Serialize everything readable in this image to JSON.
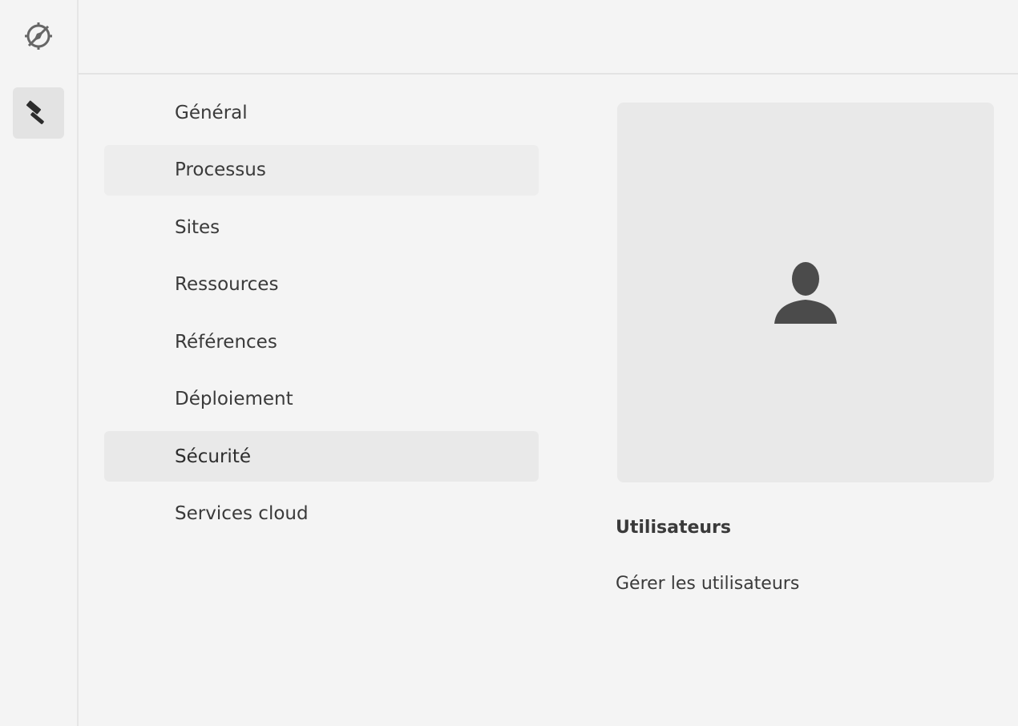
{
  "rail": {
    "items": [
      {
        "icon": "compass-off-icon"
      },
      {
        "icon": "hammer-icon",
        "selected": true
      }
    ]
  },
  "nav": {
    "items": [
      {
        "label": "Général"
      },
      {
        "label": "Processus"
      },
      {
        "label": "Sites"
      },
      {
        "label": "Ressources"
      },
      {
        "label": "Références"
      },
      {
        "label": "Déploiement"
      },
      {
        "label": "Sécurité"
      },
      {
        "label": "Services cloud"
      }
    ]
  },
  "card": {
    "icon": "user-icon",
    "title": "Utilisateurs",
    "description": "Gérer les utilisateurs"
  },
  "colors": {
    "background": "#f4f4f4",
    "selected_item": "#e9e9e9",
    "card_background": "#e9e9e9",
    "icon": "#4b4b4b"
  }
}
